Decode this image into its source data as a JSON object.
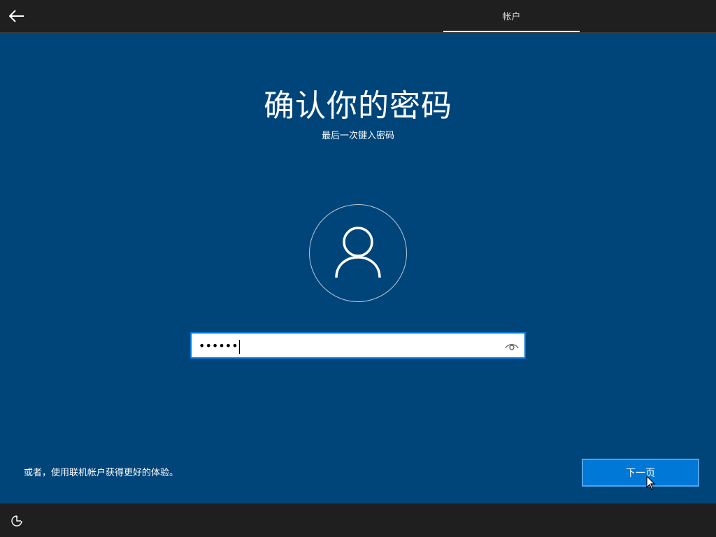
{
  "header": {
    "back_icon": "back-arrow-icon",
    "tab_label": "帐户"
  },
  "main": {
    "title": "确认你的密码",
    "subtitle": "最后一次键入密码",
    "avatar_icon": "user-icon",
    "password": {
      "masked_value": "••••••",
      "reveal_icon": "eye-icon"
    }
  },
  "footer": {
    "alt_link": "或者，使用联机帐户获得更好的体验。",
    "next_label": "下一页",
    "accessibility_icon": "ease-of-access-icon"
  },
  "colors": {
    "background": "#00457a",
    "bars": "#1f1f1f",
    "accent": "#0078d7"
  }
}
